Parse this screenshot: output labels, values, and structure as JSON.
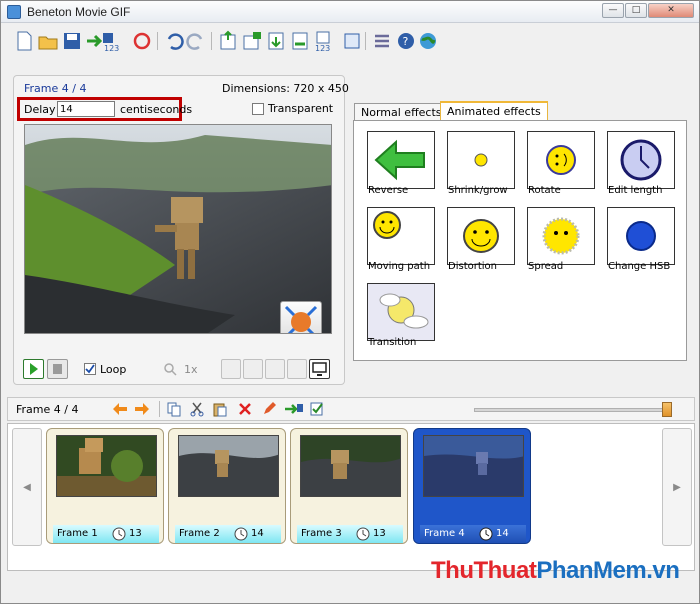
{
  "window": {
    "title": "Beneton Movie GIF",
    "buttons": [
      "—",
      "□",
      "✕"
    ]
  },
  "frame_panel": {
    "frame_label": "Frame 4 / 4",
    "dimensions": "Dimensions: 720 x 450",
    "delay_label": "Delay",
    "delay_value": "14",
    "delay_unit": "centiseconds",
    "transparent_label": "Transparent",
    "loop_label": "Loop",
    "zoom_value": "1x"
  },
  "tabs": [
    "Normal effects",
    "Animated effects"
  ],
  "effects": [
    "Reverse",
    "Shrink/grow",
    "Rotate",
    "Edit length",
    "Moving path",
    "Distortion",
    "Spread",
    "Change HSB",
    "Transition"
  ],
  "strip": {
    "frame_label": "Frame 4 / 4",
    "slider_value": 0.98
  },
  "frames": [
    {
      "label": "Frame 1",
      "delay": "13"
    },
    {
      "label": "Frame 2",
      "delay": "14"
    },
    {
      "label": "Frame 3",
      "delay": "13"
    },
    {
      "label": "Frame 4",
      "delay": "14"
    }
  ],
  "watermark": {
    "thu": "Thu",
    "thuat": "Thuat",
    "phan": "Phan",
    "mem": "Mem",
    ".vn": ".vn"
  },
  "colors": {
    "accent": "#1f56c9",
    "delay_box": "#c00000",
    "watermark_red": "#e3262c",
    "watermark_blue": "#1b6fc0"
  }
}
